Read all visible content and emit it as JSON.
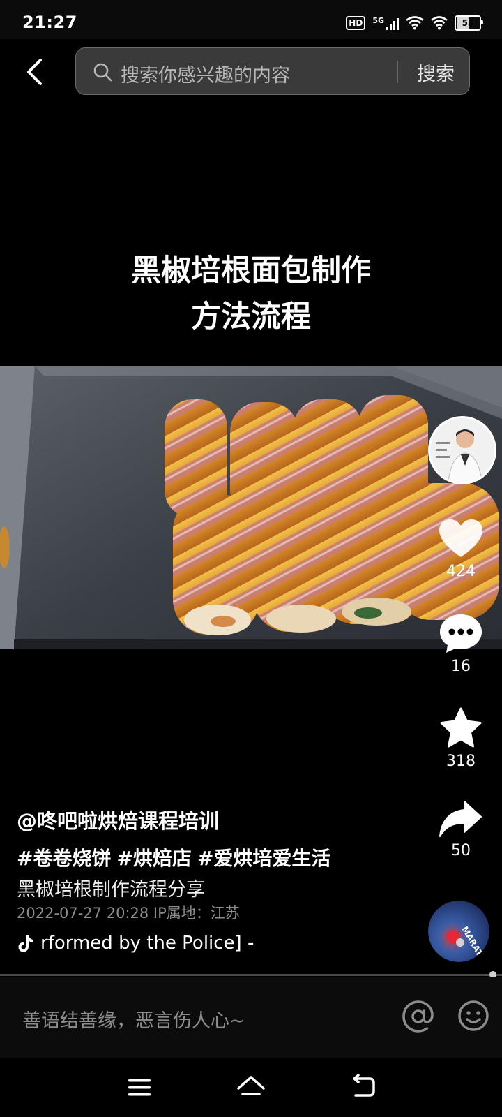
{
  "status_bar": {
    "time": "21:27",
    "hd_label": "HD",
    "network_label": "5G",
    "battery_level": "53"
  },
  "search": {
    "placeholder": "搜索你感兴趣的内容",
    "button_label": "搜索"
  },
  "video": {
    "title_line1": "黑椒培根面包制作",
    "title_line2": "方法流程"
  },
  "actions": {
    "likes": "424",
    "comments": "16",
    "favorites": "318",
    "shares": "50"
  },
  "post": {
    "author": "@咚吧啦烘焙课程培训",
    "hashtags": [
      "#卷卷烧饼",
      "#烘焙店",
      "#爱烘培爱生活"
    ],
    "description": "黑椒培根制作流程分享",
    "meta": "2022-07-27 20:28  IP属地：江苏",
    "music": "rformed by the Police] -",
    "disc_text": "MARATONA MAESTRO"
  },
  "comment_bar": {
    "placeholder": "善语结善缘，恶言伤人心~"
  },
  "colors": {
    "background": "#000000",
    "search_bg": "#3a3a3a",
    "meta_text": "#8d8d8d"
  }
}
